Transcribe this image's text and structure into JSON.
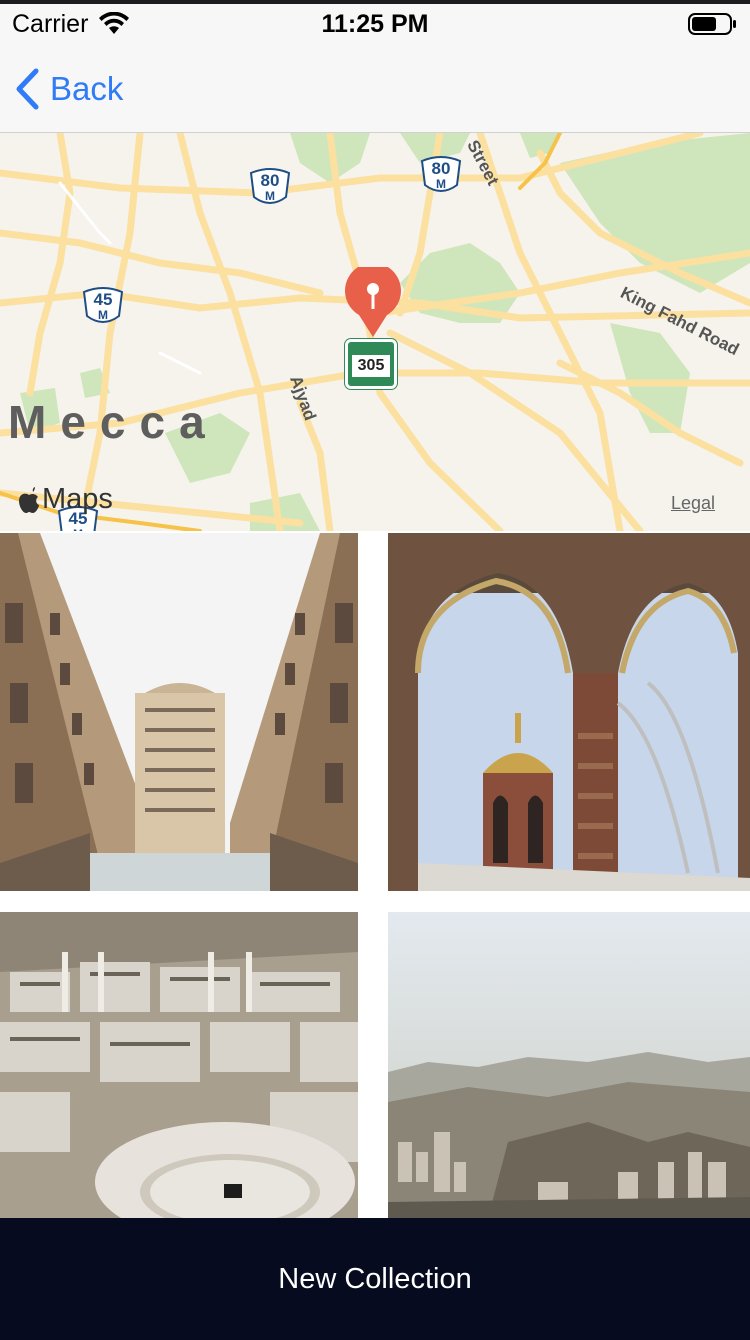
{
  "status_bar": {
    "carrier": "Carrier",
    "time": "11:25 PM",
    "icons": [
      "wifi-icon",
      "battery-icon"
    ]
  },
  "nav_bar": {
    "back_label": "Back",
    "back_icon": "chevron-left-icon",
    "accent_color": "#2f7cf6"
  },
  "map": {
    "city_label": "Mecca",
    "streets": [
      "Ajyad",
      "King Fahd Road",
      "Street"
    ],
    "route_shields": [
      {
        "number": "80",
        "suffix": "M"
      },
      {
        "number": "80",
        "suffix": "M"
      },
      {
        "number": "45",
        "suffix": "M"
      },
      {
        "number": "45",
        "suffix": "M"
      }
    ],
    "poi_number": "305",
    "attribution": "Maps",
    "legal": "Legal",
    "pin_color": "#e8604a"
  },
  "photos": [
    {
      "id": "photo-1",
      "subject": "towers-street-view"
    },
    {
      "id": "photo-2",
      "subject": "arched-balcony-minaret"
    },
    {
      "id": "photo-3",
      "subject": "aerial-grand-mosque"
    },
    {
      "id": "photo-4",
      "subject": "aerial-mountain-city"
    }
  ],
  "footer": {
    "button_label": "New Collection",
    "button_color": "#070b20"
  }
}
